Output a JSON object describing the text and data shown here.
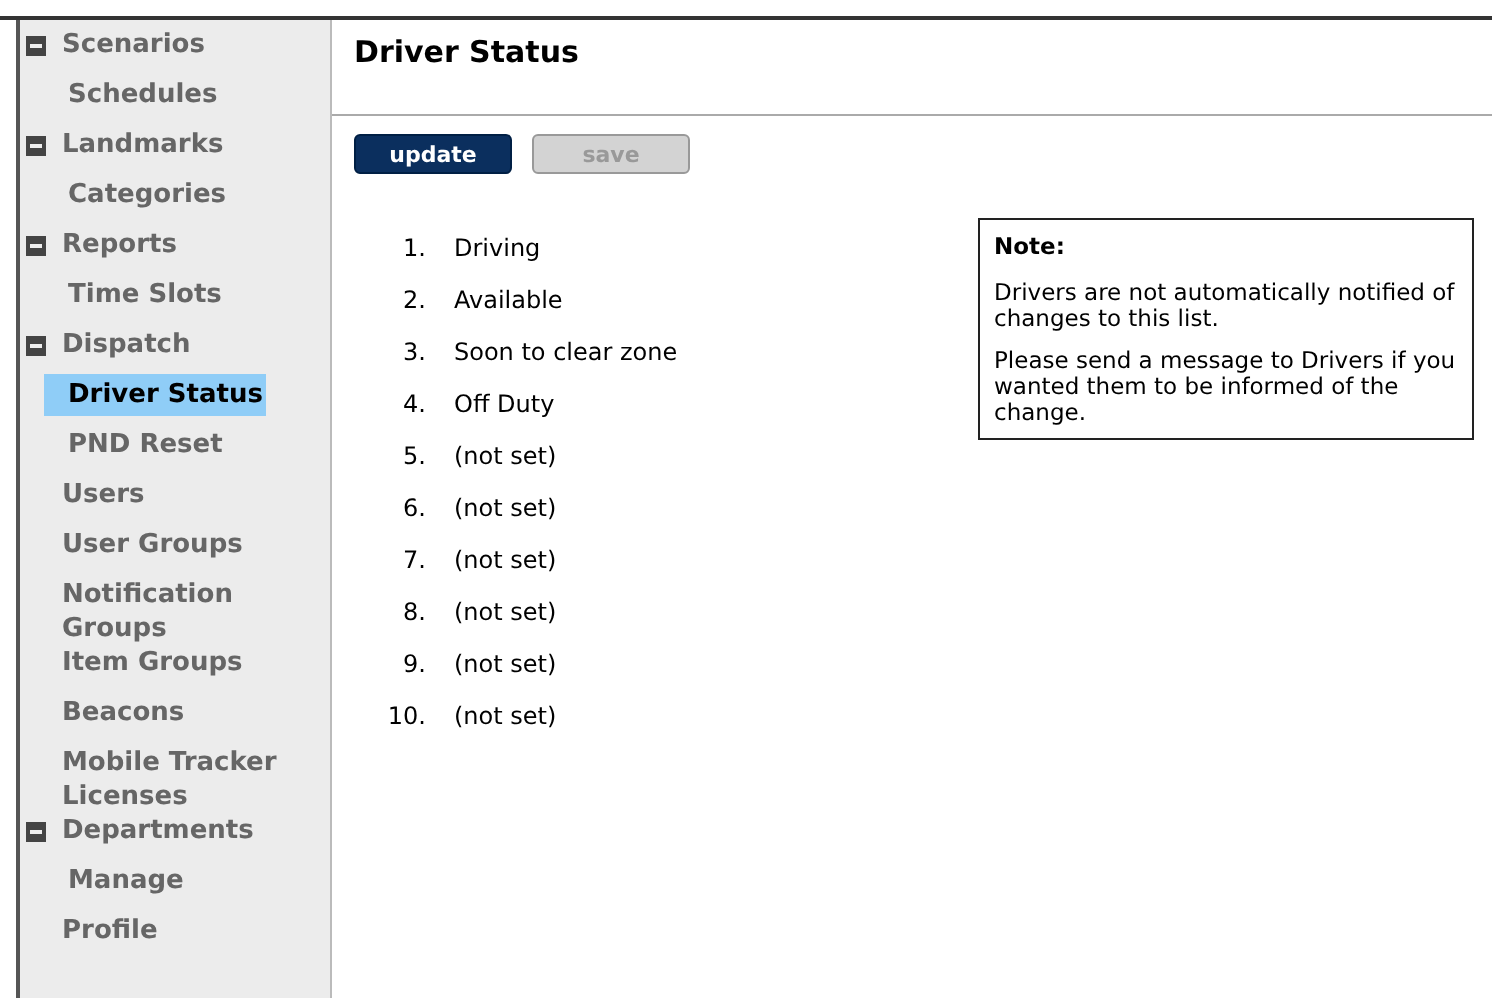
{
  "sidebar": {
    "items": [
      {
        "label": "Scenarios",
        "expanded": true,
        "selected": false,
        "children": [
          {
            "label": "Schedules",
            "selected": false
          }
        ]
      },
      {
        "label": "Landmarks",
        "expanded": true,
        "selected": false,
        "children": [
          {
            "label": "Categories",
            "selected": false
          }
        ]
      },
      {
        "label": "Reports",
        "expanded": true,
        "selected": false,
        "children": [
          {
            "label": "Time Slots",
            "selected": false
          }
        ]
      },
      {
        "label": "Dispatch",
        "expanded": true,
        "selected": false,
        "children": [
          {
            "label": "Driver Status",
            "selected": true
          },
          {
            "label": "PND Reset",
            "selected": false
          }
        ]
      },
      {
        "label": "Users",
        "selected": false
      },
      {
        "label": "User Groups",
        "selected": false
      },
      {
        "label": "Notification Groups",
        "selected": false
      },
      {
        "label": "Item Groups",
        "selected": false
      },
      {
        "label": "Beacons",
        "selected": false
      },
      {
        "label": "Mobile Tracker Licenses",
        "selected": false
      },
      {
        "label": "Departments",
        "expanded": true,
        "selected": false,
        "children": [
          {
            "label": "Manage",
            "selected": false
          }
        ]
      },
      {
        "label": "Profile",
        "selected": false
      }
    ]
  },
  "page": {
    "title": "Driver Status",
    "buttons": [
      {
        "label": "update",
        "disabled": false
      },
      {
        "label": "save",
        "disabled": true
      }
    ],
    "statuses": [
      {
        "number": "1.",
        "label": "Driving"
      },
      {
        "number": "2.",
        "label": "Available"
      },
      {
        "number": "3.",
        "label": "Soon to clear zone"
      },
      {
        "number": "4.",
        "label": "Off Duty"
      },
      {
        "number": "5.",
        "label": "(not set)"
      },
      {
        "number": "6.",
        "label": "(not set)"
      },
      {
        "number": "7.",
        "label": "(not set)"
      },
      {
        "number": "8.",
        "label": "(not set)"
      },
      {
        "number": "9.",
        "label": "(not set)"
      },
      {
        "number": "10.",
        "label": "(not set)"
      }
    ],
    "note": {
      "title": "Note:",
      "paragraphs": [
        "Drivers are not automatically notified of changes to this list.",
        "Please send a message to Drivers if you wanted them to be informed of the change."
      ]
    }
  }
}
